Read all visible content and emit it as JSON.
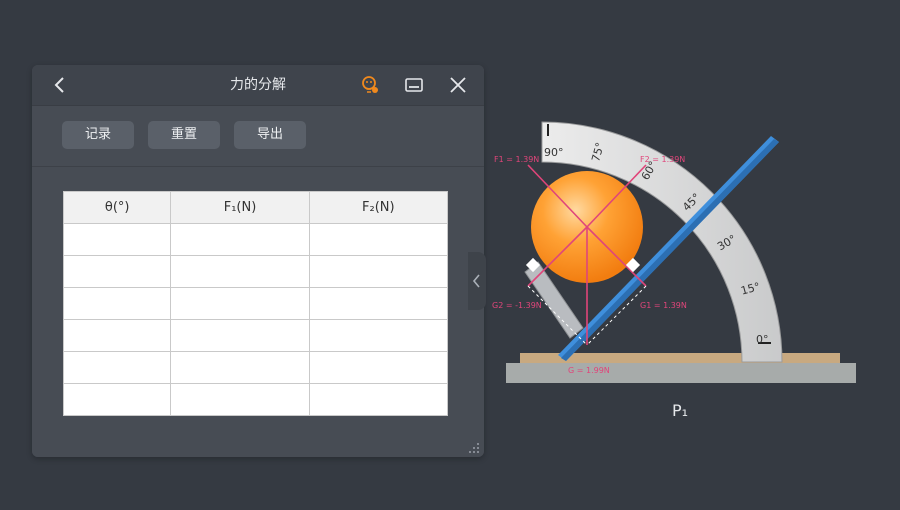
{
  "panel": {
    "title": "力的分解",
    "icons": {
      "back": "chevron-left-icon",
      "help": "help-bulb-icon",
      "minimize": "minimize-icon",
      "close": "close-icon",
      "resize": "resize-grip-icon"
    },
    "buttons": {
      "record": "记录",
      "reset": "重置",
      "export": "导出"
    },
    "table": {
      "headers": [
        "θ(°)",
        "F₁(N)",
        "F₂(N)"
      ],
      "rows": [
        [
          "",
          "",
          ""
        ],
        [
          "",
          "",
          ""
        ],
        [
          "",
          "",
          ""
        ],
        [
          "",
          "",
          ""
        ],
        [
          "",
          "",
          ""
        ],
        [
          "",
          "",
          ""
        ]
      ]
    }
  },
  "scene": {
    "protractor_ticks": [
      "90°",
      "75°",
      "60°",
      "45°",
      "30°",
      "15°",
      "0°"
    ],
    "force_labels": {
      "f1": "F1 = 1.39N",
      "f2": "F2 = 1.39N",
      "g2": "G2 = -1.39N",
      "g1": "G1 = 1.39N",
      "g": "G = 1.99N"
    },
    "caption": "P₁",
    "colors": {
      "force": "#e0457a",
      "board": "#3f8fdc",
      "ball": "#ff9a22",
      "protractor": "#d9dadb"
    }
  }
}
